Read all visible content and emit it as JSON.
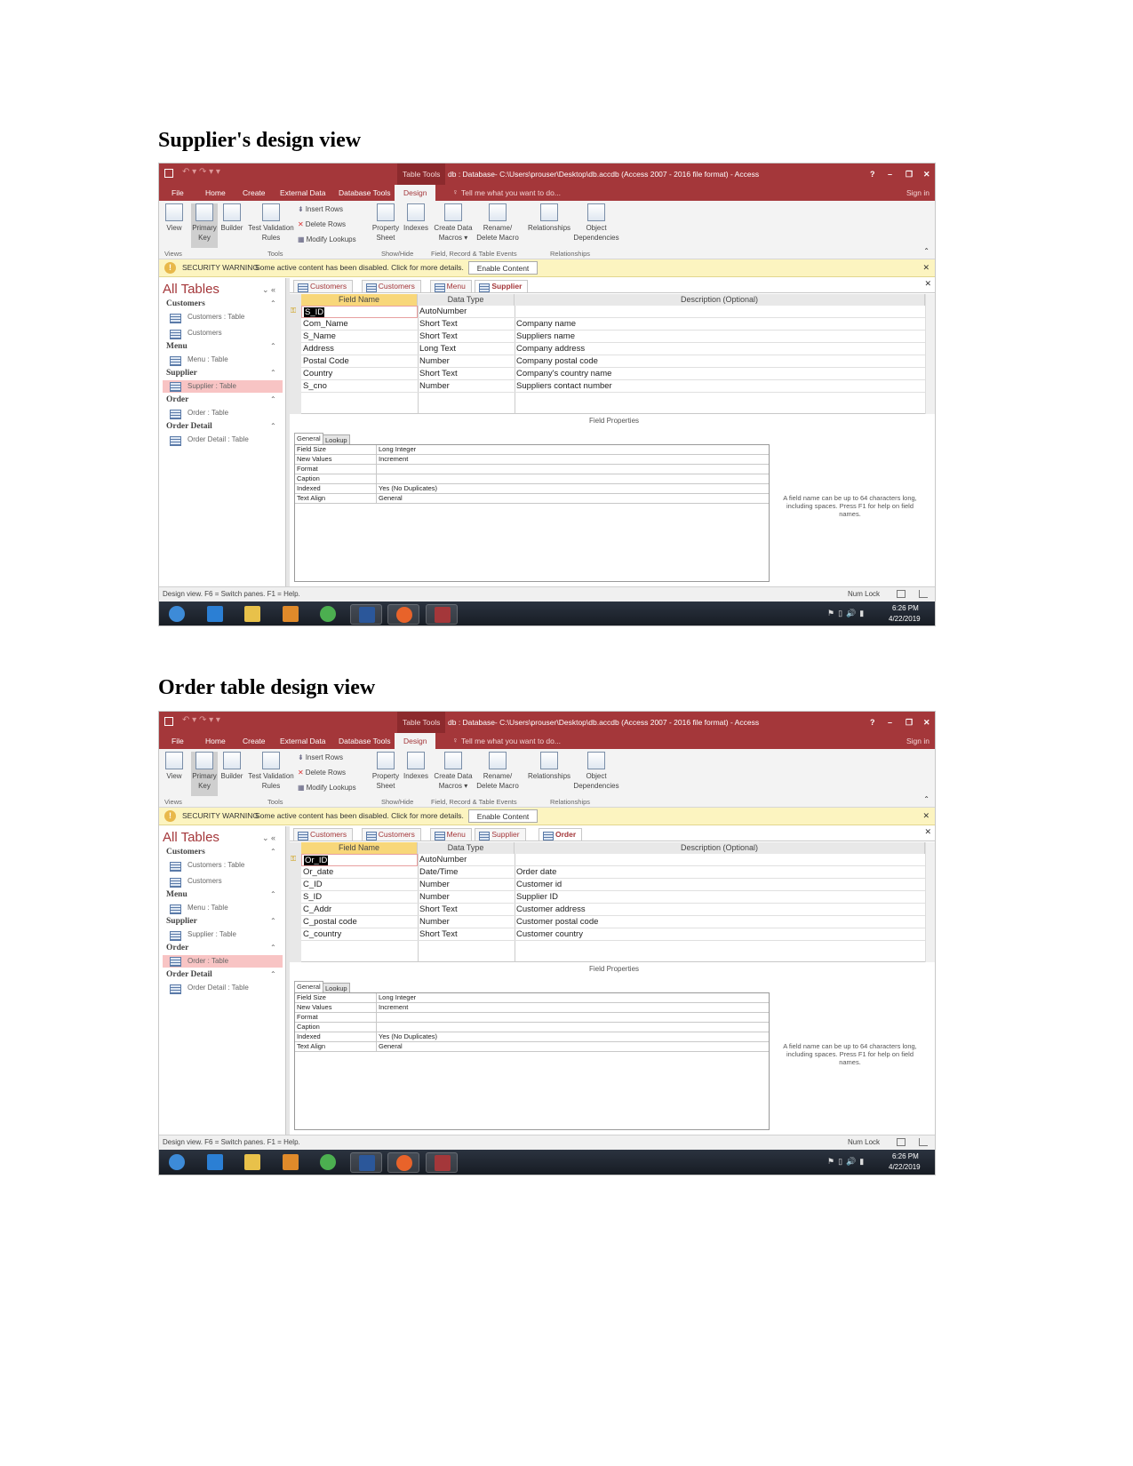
{
  "screens": [
    {
      "heading": "Supplier's design view",
      "title_context": "Table Tools",
      "title": "db : Database- C:\\Users\\prouser\\Desktop\\db.accdb (Access 2007 - 2016 file format) - Access",
      "window_controls": [
        "?",
        "–",
        "❐",
        "✕"
      ],
      "ribbon_tabs": [
        "File",
        "Home",
        "Create",
        "External Data",
        "Database Tools",
        "Design"
      ],
      "active_ribbon_tab": "Design",
      "tell_me": "Tell me what you want to do...",
      "sign_in": "Sign in",
      "ribbon": {
        "view": "View",
        "primary_key": "Primary Key",
        "builder": "Builder",
        "test_validation": "Test Validation Rules",
        "insert_rows": "Insert Rows",
        "delete_rows": "Delete Rows",
        "modify_lookups": "Modify Lookups",
        "property_sheet": "Property Sheet",
        "indexes": "Indexes",
        "create_data_macros": "Create Data Macros ▾",
        "rename_delete_macro": "Rename/ Delete Macro",
        "relationships": "Relationships",
        "object_dependencies": "Object Dependencies",
        "groups": [
          "Views",
          "Tools",
          "Show/Hide",
          "Field, Record & Table Events",
          "Relationships"
        ]
      },
      "security": {
        "label": "SECURITY WARNING",
        "message": "Some active content has been disabled. Click for more details.",
        "button": "Enable Content"
      },
      "nav": {
        "title": "All Tables",
        "items": [
          {
            "type": "group",
            "label": "Customers"
          },
          {
            "type": "object",
            "label": "Customers : Table"
          },
          {
            "type": "object",
            "label": "Customers"
          },
          {
            "type": "group",
            "label": "Menu"
          },
          {
            "type": "object",
            "label": "Menu : Table"
          },
          {
            "type": "group",
            "label": "Supplier"
          },
          {
            "type": "object",
            "label": "Supplier : Table",
            "selected": true
          },
          {
            "type": "group",
            "label": "Order"
          },
          {
            "type": "object",
            "label": "Order : Table"
          },
          {
            "type": "group",
            "label": "Order Detail"
          },
          {
            "type": "object",
            "label": "Order Detail : Table"
          }
        ]
      },
      "doc_tabs": [
        "Customers",
        "Customers",
        "Menu",
        "Supplier"
      ],
      "active_doc_tab": 3,
      "grid_headers": [
        "Field Name",
        "Data Type",
        "Description (Optional)"
      ],
      "fields": [
        [
          "S_ID",
          "AutoNumber",
          ""
        ],
        [
          "Com_Name",
          "Short Text",
          "Company name"
        ],
        [
          "S_Name",
          "Short Text",
          "Suppliers name"
        ],
        [
          "Address",
          "Long Text",
          "Company address"
        ],
        [
          "Postal Code",
          "Number",
          "Company postal code"
        ],
        [
          "Country",
          "Short Text",
          "Company's country name"
        ],
        [
          "S_cno",
          "Number",
          "Suppliers contact number"
        ]
      ],
      "field_properties_label": "Field Properties",
      "prop_tabs": [
        "General",
        "Lookup"
      ],
      "properties": [
        [
          "Field Size",
          "Long Integer"
        ],
        [
          "New Values",
          "Increment"
        ],
        [
          "Format",
          ""
        ],
        [
          "Caption",
          ""
        ],
        [
          "Indexed",
          "Yes (No Duplicates)"
        ],
        [
          "Text Align",
          "General"
        ]
      ],
      "help_text": "A field name can be up to 64 characters long, including spaces. Press F1 for help on field names.",
      "status_text": "Design view.  F6 = Switch panes.  F1 = Help.",
      "num_lock": "Num Lock",
      "clock_time": "6:26 PM",
      "clock_date": "4/22/2019"
    },
    {
      "heading": "Order table design view",
      "title_context": "Table Tools",
      "title": "db : Database- C:\\Users\\prouser\\Desktop\\db.accdb (Access 2007 - 2016 file format) - Access",
      "window_controls": [
        "?",
        "–",
        "❐",
        "✕"
      ],
      "ribbon_tabs": [
        "File",
        "Home",
        "Create",
        "External Data",
        "Database Tools",
        "Design"
      ],
      "active_ribbon_tab": "Design",
      "tell_me": "Tell me what you want to do...",
      "sign_in": "Sign in",
      "ribbon": {
        "view": "View",
        "primary_key": "Primary Key",
        "builder": "Builder",
        "test_validation": "Test Validation Rules",
        "insert_rows": "Insert Rows",
        "delete_rows": "Delete Rows",
        "modify_lookups": "Modify Lookups",
        "property_sheet": "Property Sheet",
        "indexes": "Indexes",
        "create_data_macros": "Create Data Macros ▾",
        "rename_delete_macro": "Rename/ Delete Macro",
        "relationships": "Relationships",
        "object_dependencies": "Object Dependencies",
        "groups": [
          "Views",
          "Tools",
          "Show/Hide",
          "Field, Record & Table Events",
          "Relationships"
        ]
      },
      "security": {
        "label": "SECURITY WARNING",
        "message": "Some active content has been disabled. Click for more details.",
        "button": "Enable Content"
      },
      "nav": {
        "title": "All Tables",
        "items": [
          {
            "type": "group",
            "label": "Customers"
          },
          {
            "type": "object",
            "label": "Customers : Table"
          },
          {
            "type": "object",
            "label": "Customers"
          },
          {
            "type": "group",
            "label": "Menu"
          },
          {
            "type": "object",
            "label": "Menu : Table"
          },
          {
            "type": "group",
            "label": "Supplier"
          },
          {
            "type": "object",
            "label": "Supplier : Table"
          },
          {
            "type": "group",
            "label": "Order"
          },
          {
            "type": "object",
            "label": "Order : Table",
            "selected": true
          },
          {
            "type": "group",
            "label": "Order Detail"
          },
          {
            "type": "object",
            "label": "Order Detail : Table"
          }
        ]
      },
      "doc_tabs": [
        "Customers",
        "Customers",
        "Menu",
        "Supplier",
        "Order"
      ],
      "active_doc_tab": 4,
      "grid_headers": [
        "Field Name",
        "Data Type",
        "Description (Optional)"
      ],
      "fields": [
        [
          "Or_ID",
          "AutoNumber",
          ""
        ],
        [
          "Or_date",
          "Date/Time",
          "Order date"
        ],
        [
          "C_ID",
          "Number",
          "Customer id"
        ],
        [
          "S_ID",
          "Number",
          "Supplier ID"
        ],
        [
          "C_Addr",
          "Short Text",
          "Customer address"
        ],
        [
          "C_postal code",
          "Number",
          "Customer postal code"
        ],
        [
          "C_country",
          "Short Text",
          "Customer country"
        ]
      ],
      "field_properties_label": "Field Properties",
      "prop_tabs": [
        "General",
        "Lookup"
      ],
      "properties": [
        [
          "Field Size",
          "Long Integer"
        ],
        [
          "New Values",
          "Increment"
        ],
        [
          "Format",
          ""
        ],
        [
          "Caption",
          ""
        ],
        [
          "Indexed",
          "Yes (No Duplicates)"
        ],
        [
          "Text Align",
          "General"
        ]
      ],
      "help_text": "A field name can be up to 64 characters long, including spaces. Press F1 for help on field names.",
      "status_text": "Design view.  F6 = Switch panes.  F1 = Help.",
      "num_lock": "Num Lock",
      "clock_time": "6:26 PM",
      "clock_date": "4/22/2019"
    }
  ],
  "colors": {
    "access_red": "#a4373a",
    "security_bar": "#fcf4c0",
    "header_yellow": "#f8d77a",
    "selected_nav": "#f8c4c4"
  },
  "taskbar_icons": [
    "start-orb-icon",
    "internet-explorer-icon",
    "file-explorer-icon",
    "media-player-icon",
    "chrome-icon",
    "word-icon",
    "firefox-icon",
    "access-icon"
  ]
}
